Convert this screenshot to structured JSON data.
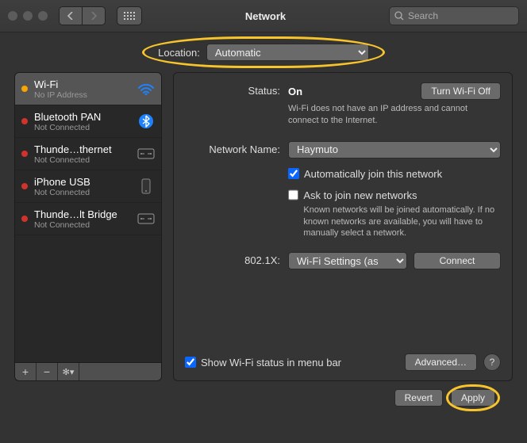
{
  "titlebar": {
    "title": "Network",
    "search_placeholder": "Search"
  },
  "location": {
    "label": "Location:",
    "value": "Automatic"
  },
  "sidebar": {
    "items": [
      {
        "name": "Wi-Fi",
        "sub": "No IP Address"
      },
      {
        "name": "Bluetooth PAN",
        "sub": "Not Connected"
      },
      {
        "name": "Thunde…thernet",
        "sub": "Not Connected"
      },
      {
        "name": "iPhone USB",
        "sub": "Not Connected"
      },
      {
        "name": "Thunde…lt Bridge",
        "sub": "Not Connected"
      }
    ]
  },
  "details": {
    "status_label": "Status:",
    "status_value": "On",
    "wifi_off_btn": "Turn Wi-Fi Off",
    "status_note": "Wi-Fi does not have an IP address and cannot connect to the Internet.",
    "netname_label": "Network Name:",
    "netname_value": "Haymuto",
    "auto_join": "Automatically join this network",
    "ask_join": "Ask to join new networks",
    "ask_note": "Known networks will be joined automatically. If no known networks are available, you will have to manually select a network.",
    "eight_label": "802.1X:",
    "eight_value": "Wi-Fi Settings (as…",
    "connect_btn": "Connect",
    "show_status": "Show Wi-Fi status in menu bar",
    "advanced_btn": "Advanced…"
  },
  "bottom": {
    "revert": "Revert",
    "apply": "Apply"
  }
}
